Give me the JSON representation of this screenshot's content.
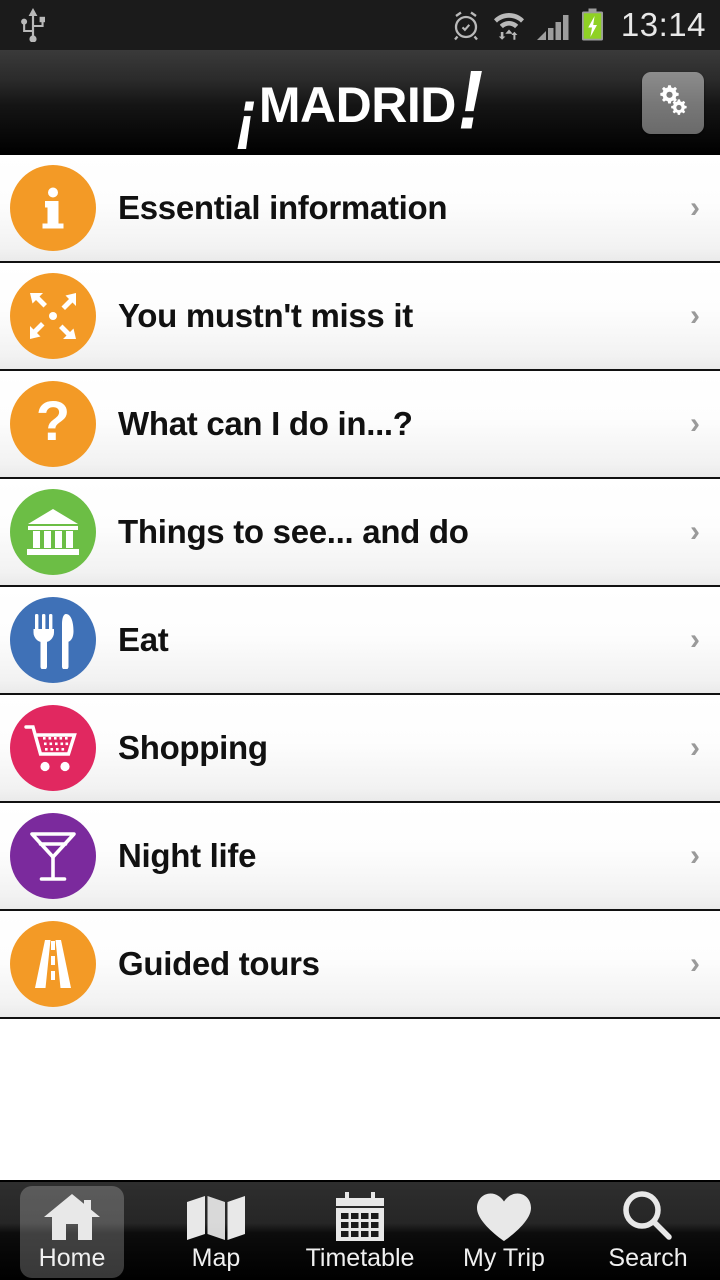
{
  "status_bar": {
    "time": "13:14",
    "left_icons": [
      {
        "name": "usb-icon"
      }
    ],
    "right_icons": [
      {
        "name": "alarm-clock-icon"
      },
      {
        "name": "wifi-data-transfer-icon"
      },
      {
        "name": "signal-bars-icon"
      },
      {
        "name": "battery-charging-icon"
      }
    ]
  },
  "header": {
    "logo_bang_left": "¡",
    "logo_word": "MADRID",
    "logo_bang_right": "!",
    "settings_icon": "gears-icon"
  },
  "menu": {
    "chevron": "›",
    "items": [
      {
        "label": "Essential information",
        "icon": "info-icon",
        "color": "#F39A26"
      },
      {
        "label": "You mustn't miss it",
        "icon": "converging-arrows-icon",
        "color": "#F39A26"
      },
      {
        "label": "What can I do in...?",
        "icon": "question-mark-icon",
        "color": "#F39A26"
      },
      {
        "label": "Things to see... and do",
        "icon": "museum-building-icon",
        "color": "#6CBE45"
      },
      {
        "label": "Eat",
        "icon": "fork-knife-icon",
        "color": "#3F71B7"
      },
      {
        "label": "Shopping",
        "icon": "shopping-cart-icon",
        "color": "#E12860"
      },
      {
        "label": "Night life",
        "icon": "cocktail-glass-icon",
        "color": "#7B2A9D"
      },
      {
        "label": "Guided tours",
        "icon": "road-icon",
        "color": "#F39A26"
      }
    ]
  },
  "tab_bar": {
    "active_index": 0,
    "tabs": [
      {
        "label": "Home",
        "icon": "house-icon"
      },
      {
        "label": "Map",
        "icon": "folded-map-icon"
      },
      {
        "label": "Timetable",
        "icon": "calendar-icon"
      },
      {
        "label": "My Trip",
        "icon": "heart-icon"
      },
      {
        "label": "Search",
        "icon": "magnifier-icon"
      }
    ]
  }
}
